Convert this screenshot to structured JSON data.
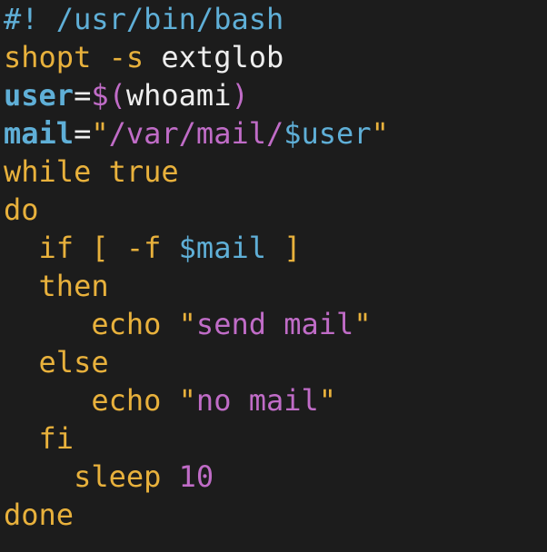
{
  "colors": {
    "background": "#1c1c1c",
    "keyword": "#e8b13c",
    "variable": "#5fafd7",
    "string": "#c06cc7",
    "text": "#eeeeee"
  },
  "code": {
    "l1": {
      "shebang": "#! /usr/bin/bash"
    },
    "l2": {
      "cmd": "shopt",
      "flag": " -s",
      "arg": " extglob"
    },
    "l3": {
      "name": "user",
      "eq": "=",
      "subst_open": "$(",
      "subst_cmd": "whoami",
      "subst_close": ")"
    },
    "l4": {
      "name": "mail",
      "eq": "=",
      "q_open": "\"",
      "str": "/var/mail/",
      "ref": "$user",
      "q_close": "\""
    },
    "l5": {
      "kw1": "while",
      "kw2": " true"
    },
    "l6": {
      "kw": "do"
    },
    "l7": {
      "indent": "  ",
      "kw": "if",
      "bracket_open": " [",
      "flag": " -f",
      "ref": " $mail",
      "bracket_close": " ]"
    },
    "l8": {
      "indent": "  ",
      "kw": "then"
    },
    "l9": {
      "indent": "     ",
      "cmd": "echo",
      "q_open": " \"",
      "str": "send mail",
      "q_close": "\""
    },
    "l10": {
      "indent": "  ",
      "kw": "else"
    },
    "l11": {
      "indent": "     ",
      "cmd": "echo",
      "q_open": " \"",
      "str": "no mail",
      "q_close": "\""
    },
    "l12": {
      "indent": "  ",
      "kw": "fi"
    },
    "l13": {
      "indent": "    ",
      "cmd": "sleep",
      "num": " 10"
    },
    "l14": {
      "kw": "done"
    }
  }
}
